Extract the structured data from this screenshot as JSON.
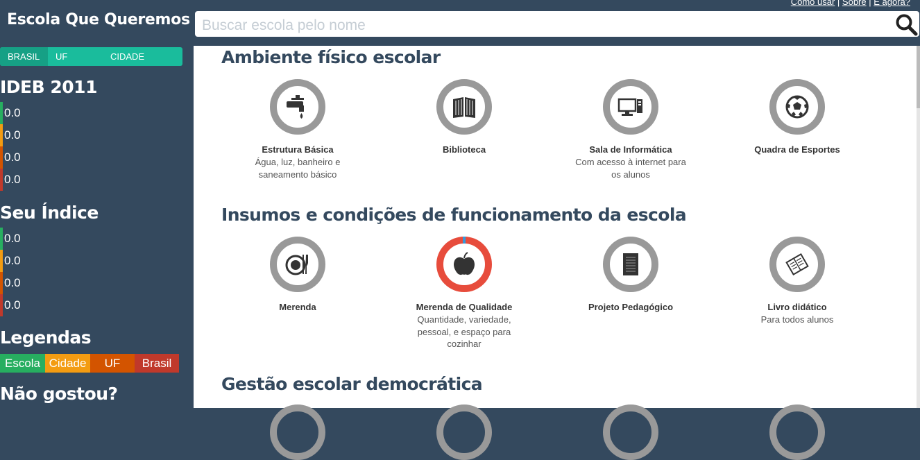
{
  "header": {
    "brand": "Escola Que Queremos",
    "links": [
      "Como usar",
      "Sobre",
      "E agora?"
    ],
    "search": {
      "placeholder": "Buscar escola pelo nome",
      "value": ""
    }
  },
  "sidebar": {
    "scope_tabs": [
      "BRASIL",
      "UF",
      "CIDADE"
    ],
    "active_scope": "BRASIL",
    "ideb": {
      "title": "IDEB 2011",
      "values": [
        "0.0",
        "0.0",
        "0.0",
        "0.0"
      ]
    },
    "seu_indice": {
      "title": "Seu Índice",
      "values": [
        "0.0",
        "0.0",
        "0.0",
        "0.0"
      ]
    },
    "legendas": {
      "title": "Legendas",
      "items": [
        "Escola",
        "Cidade",
        "UF",
        "Brasil"
      ]
    },
    "nao_gostou": "Não gostou?"
  },
  "colors": {
    "escola": "#27ae60",
    "cidade": "#f39c12",
    "uf": "#d35400",
    "brasil": "#c0392b",
    "accent": "#1abc9c",
    "navy": "#34495e",
    "ring_gray": "#999999",
    "ring_red": "#e74c3c"
  },
  "sections": [
    {
      "title": "Ambiente físico escolar",
      "items": [
        {
          "icon": "faucet-icon",
          "label": "Estrutura Básica",
          "sub": "Água, luz, banheiro e saneamento básico"
        },
        {
          "icon": "book-icon",
          "label": "Biblioteca",
          "sub": ""
        },
        {
          "icon": "computer-icon",
          "label": "Sala de Informática",
          "sub": "Com acesso à internet para os alunos"
        },
        {
          "icon": "soccer-ball-icon",
          "label": "Quadra de Esportes",
          "sub": ""
        }
      ]
    },
    {
      "title": "Insumos e condições de funcionamento da escola",
      "items": [
        {
          "icon": "plate-icon",
          "label": "Merenda",
          "sub": ""
        },
        {
          "icon": "apple-icon",
          "label": "Merenda de Qualidade",
          "sub": "Quantidade, variedade, pessoal, e espaço para cozinhar"
        },
        {
          "icon": "notebook-icon",
          "label": "Projeto Pedagógico",
          "sub": ""
        },
        {
          "icon": "textbook-icon",
          "label": "Livro didático",
          "sub": "Para todos alunos"
        }
      ]
    },
    {
      "title": "Gestão escolar democrática",
      "items": []
    }
  ]
}
